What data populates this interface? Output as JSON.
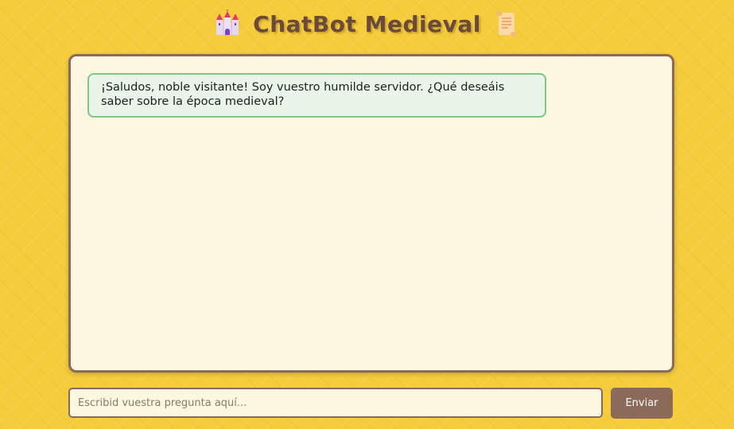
{
  "header": {
    "title": "ChatBot Medieval",
    "left_icon": "castle-icon",
    "right_icon": "scroll-icon"
  },
  "chat": {
    "messages": [
      {
        "sender": "bot",
        "text": "¡Saludos, noble visitante! Soy vuestro humilde servidor. ¿Qué deseáis saber sobre la época medieval?"
      }
    ]
  },
  "composer": {
    "placeholder": "Escribid vuestra pregunta aquí...",
    "value": "",
    "send_label": "Enviar"
  },
  "colors": {
    "background": "#f4cc3c",
    "title": "#6b4a3a",
    "panel": "#fdf6e0",
    "border": "#8b6a5a",
    "bot_bubble": "#e8f5e8",
    "bot_bubble_border": "#7fc87f",
    "button": "#8b6a5a"
  }
}
